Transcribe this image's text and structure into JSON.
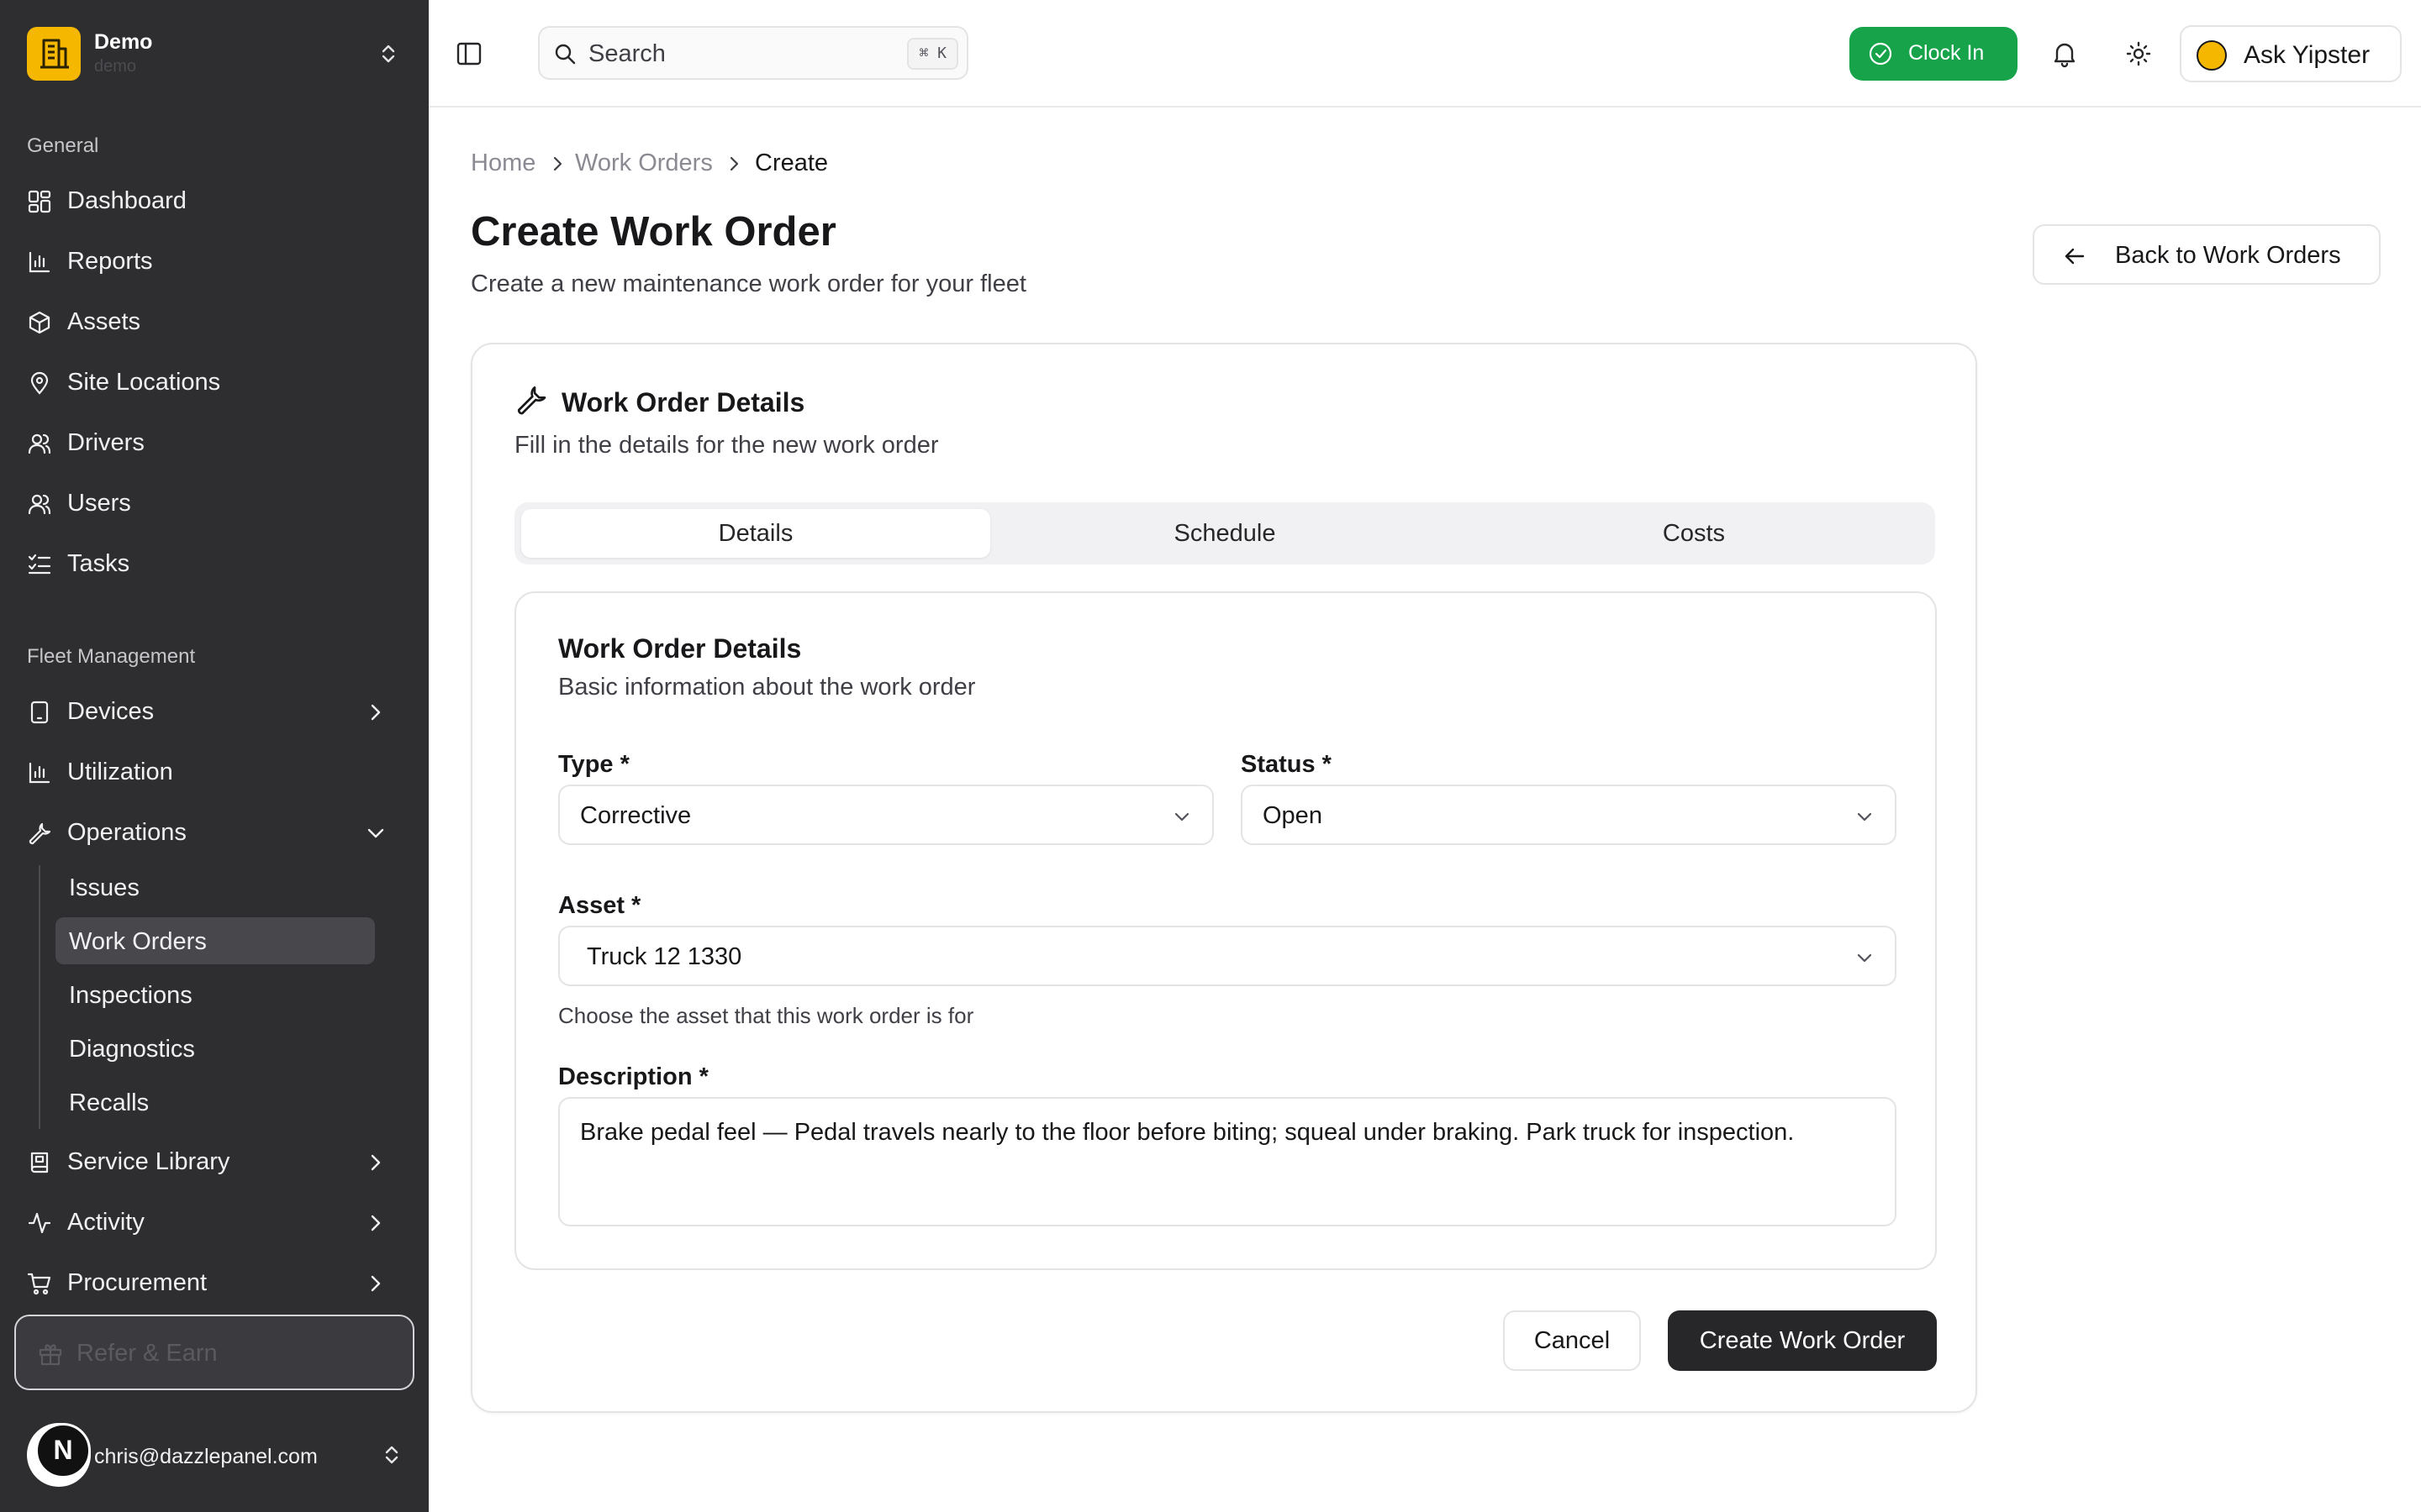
{
  "team": {
    "name": "Demo",
    "subtitle": "demo"
  },
  "sidebar": {
    "general_label": "General",
    "general_items": [
      {
        "label": "Dashboard",
        "icon": "dashboard-icon"
      },
      {
        "label": "Reports",
        "icon": "bar-chart-icon"
      },
      {
        "label": "Assets",
        "icon": "box-icon"
      },
      {
        "label": "Site Locations",
        "icon": "map-pin-icon"
      },
      {
        "label": "Drivers",
        "icon": "users-icon"
      },
      {
        "label": "Users",
        "icon": "users-icon"
      },
      {
        "label": "Tasks",
        "icon": "list-checks-icon"
      }
    ],
    "fleet_label": "Fleet Management",
    "fleet_items": [
      {
        "label": "Devices",
        "icon": "tablet-icon"
      },
      {
        "label": "Utilization",
        "icon": "bar-chart-icon"
      },
      {
        "label": "Operations",
        "icon": "wrench-icon"
      }
    ],
    "operations_sub": [
      {
        "label": "Issues"
      },
      {
        "label": "Work Orders",
        "active": true
      },
      {
        "label": "Inspections"
      },
      {
        "label": "Diagnostics"
      },
      {
        "label": "Recalls"
      }
    ],
    "more_items": [
      {
        "label": "Service Library",
        "icon": "book-icon"
      },
      {
        "label": "Activity",
        "icon": "activity-icon"
      },
      {
        "label": "Procurement",
        "icon": "cart-icon"
      }
    ],
    "refer_label": "Refer & Earn",
    "user_email": "chris@dazzlepanel.com",
    "user_initial": "N"
  },
  "topbar": {
    "search_label": "Search",
    "search_shortcut": "⌘ K",
    "clock_in_label": "Clock In",
    "ask_label": "Ask Yipster"
  },
  "breadcrumb": [
    "Home",
    "Work Orders",
    "Create"
  ],
  "page": {
    "title": "Create Work Order",
    "subtitle": "Create a new maintenance work order for your fleet",
    "back_label": "Back to Work Orders"
  },
  "card": {
    "title": "Work Order Details",
    "subtitle": "Fill in the details for the new work order",
    "tabs": [
      "Details",
      "Schedule",
      "Costs"
    ],
    "active_tab": "Details"
  },
  "form": {
    "title": "Work Order Details",
    "subtitle": "Basic information about the work order",
    "type_label": "Type *",
    "type_value": "Corrective",
    "status_label": "Status *",
    "status_value": "Open",
    "asset_label": "Asset *",
    "asset_value": "Truck 12 1330",
    "asset_help": "Choose the asset that this work order is for",
    "description_label": "Description *",
    "description_value": "Brake pedal feel — Pedal travels nearly to the floor before biting; squeal under braking. Park truck for inspection.",
    "cancel_label": "Cancel",
    "submit_label": "Create Work Order"
  },
  "colors": {
    "accent_green": "#16a34a",
    "brand_yellow": "#f5b700",
    "sidebar_bg": "#2e2e31",
    "primary_button": "#27272a"
  }
}
